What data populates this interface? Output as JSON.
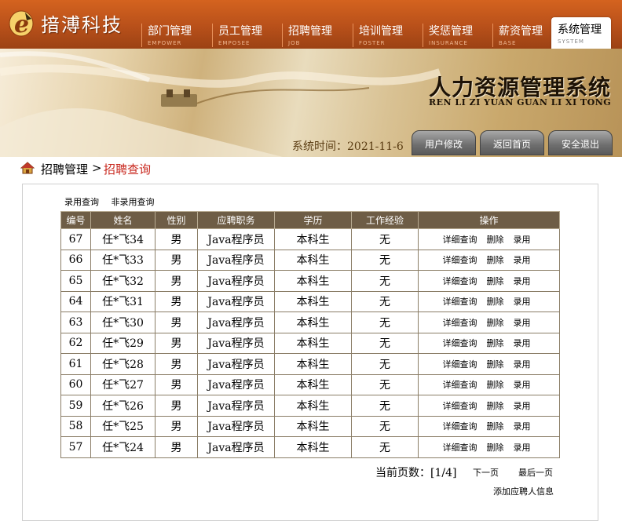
{
  "logo": {
    "text": "揞溥科技"
  },
  "nav": [
    {
      "zh": "部门管理",
      "en": "EMPOWER"
    },
    {
      "zh": "员工管理",
      "en": "EMPOSEE"
    },
    {
      "zh": "招聘管理",
      "en": "JOB"
    },
    {
      "zh": "培训管理",
      "en": "FOSTER"
    },
    {
      "zh": "奖惩管理",
      "en": "INSURANCE"
    },
    {
      "zh": "薪资管理",
      "en": "BASE"
    },
    {
      "zh": "系统管理",
      "en": "SYSTEM"
    }
  ],
  "banner": {
    "title": "人力资源管理系统",
    "subtitle": "REN LI ZI YUAN GUAN LI XI TONG",
    "time_label": "系统时间：",
    "time_value": "2021-11-6",
    "buttons": [
      "用户修改",
      "返回首页",
      "安全退出"
    ]
  },
  "breadcrumb": {
    "section": "招聘管理",
    "sep": ">",
    "page": "招聘查询"
  },
  "filters": [
    "录用查询",
    "非录用查询"
  ],
  "table": {
    "headers": [
      "编号",
      "姓名",
      "性别",
      "应聘职务",
      "学历",
      "工作经验",
      "操作"
    ],
    "rows": [
      {
        "id": "67",
        "name": "任*飞34",
        "gender": "男",
        "job": "Java程序员",
        "edu": "本科生",
        "exp": "无"
      },
      {
        "id": "66",
        "name": "任*飞33",
        "gender": "男",
        "job": "Java程序员",
        "edu": "本科生",
        "exp": "无"
      },
      {
        "id": "65",
        "name": "任*飞32",
        "gender": "男",
        "job": "Java程序员",
        "edu": "本科生",
        "exp": "无"
      },
      {
        "id": "64",
        "name": "任*飞31",
        "gender": "男",
        "job": "Java程序员",
        "edu": "本科生",
        "exp": "无"
      },
      {
        "id": "63",
        "name": "任*飞30",
        "gender": "男",
        "job": "Java程序员",
        "edu": "本科生",
        "exp": "无"
      },
      {
        "id": "62",
        "name": "任*飞29",
        "gender": "男",
        "job": "Java程序员",
        "edu": "本科生",
        "exp": "无"
      },
      {
        "id": "61",
        "name": "任*飞28",
        "gender": "男",
        "job": "Java程序员",
        "edu": "本科生",
        "exp": "无"
      },
      {
        "id": "60",
        "name": "任*飞27",
        "gender": "男",
        "job": "Java程序员",
        "edu": "本科生",
        "exp": "无"
      },
      {
        "id": "59",
        "name": "任*飞26",
        "gender": "男",
        "job": "Java程序员",
        "edu": "本科生",
        "exp": "无"
      },
      {
        "id": "58",
        "name": "任*飞25",
        "gender": "男",
        "job": "Java程序员",
        "edu": "本科生",
        "exp": "无"
      },
      {
        "id": "57",
        "name": "任*飞24",
        "gender": "男",
        "job": "Java程序员",
        "edu": "本科生",
        "exp": "无"
      }
    ],
    "actions": [
      "详细查询",
      "删除",
      "录用"
    ]
  },
  "pager": {
    "label": "当前页数：",
    "value": "[1/4]",
    "next": "下一页",
    "last": "最后一页"
  },
  "add_link": "添加应聘人信息",
  "colors": {
    "header": "#b8501a",
    "table_header": "#6e5d46",
    "crumb_active": "#c8261c"
  }
}
